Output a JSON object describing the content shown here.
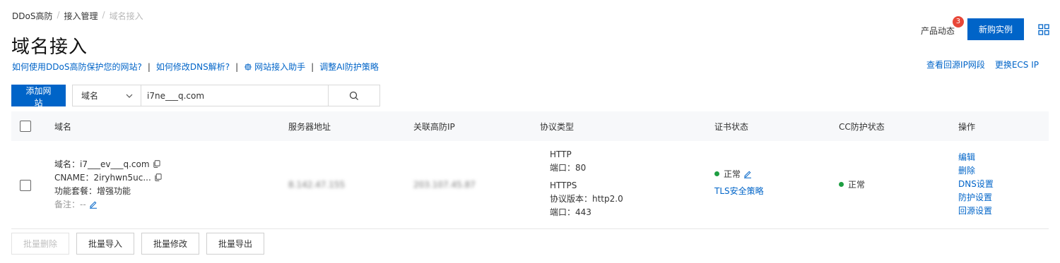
{
  "breadcrumb": [
    "DDoS高防",
    "接入管理",
    "域名接入"
  ],
  "page_title": "域名接入",
  "help_links": [
    "如何使用DDoS高防保护您的网站?",
    "如何修改DNS解析?",
    "网站接入助手",
    "调整AI防护策略"
  ],
  "top_right": {
    "news_label": "产品动态",
    "news_count": "3",
    "buy_label": "新购实例",
    "links": [
      "查看回源IP网段",
      "更换ECS IP"
    ]
  },
  "toolbar": {
    "add_label": "添加网站",
    "filter_value": "域名",
    "search_value": "i7ne___q.com"
  },
  "table": {
    "headers": [
      "域名",
      "服务器地址",
      "关联高防IP",
      "协议类型",
      "证书状态",
      "CC防护状态",
      "操作"
    ],
    "row": {
      "domain_line": "域名：i7___ev___q.com",
      "cname_line": "CNAME：2iryhwn5uc...",
      "package_line": "功能套餐：增强功能",
      "note_label": "备注：",
      "note_value": "--",
      "server": "8.142.47.155",
      "defense_ip": "203.107.45.87",
      "protocols": [
        "HTTP",
        "端口：80",
        "HTTPS",
        "协议版本：http2.0",
        "端口：443"
      ],
      "cert_status": "正常",
      "tls_link": "TLS安全策略",
      "cc_status": "正常",
      "actions": [
        "编辑",
        "删除",
        "DNS设置",
        "防护设置",
        "回源设置"
      ]
    }
  },
  "bottom_actions": [
    "批量删除",
    "批量导入",
    "批量修改",
    "批量导出"
  ],
  "colors": {
    "primary": "#0064c8",
    "badge": "#e84738",
    "status_ok": "#1e9e42"
  }
}
